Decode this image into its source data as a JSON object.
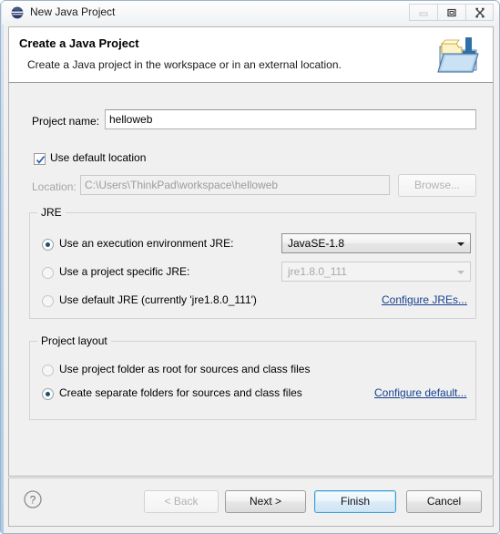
{
  "window": {
    "title": "New Java Project",
    "icon": "eclipse-globe-icon",
    "controls": {
      "minimize": "minimize-icon",
      "maximize": "maximize-icon",
      "close": "close-icon"
    }
  },
  "header": {
    "title": "Create a Java Project",
    "subtitle": "Create a Java project in the workspace or in an external location.",
    "icon": "new-java-project-banner-icon"
  },
  "form": {
    "project_name_label": "Project name:",
    "project_name_value": "helloweb",
    "project_name_placeholder": "",
    "use_default_location_label": "Use default location",
    "use_default_location_checked": true,
    "location_label": "Location:",
    "location_value": "C:\\Users\\ThinkPad\\workspace\\helloweb",
    "browse_label": "Browse..."
  },
  "jre": {
    "group_title": "JRE",
    "options": [
      {
        "label": "Use an execution environment JRE:",
        "selected": true
      },
      {
        "label": "Use a project specific JRE:",
        "selected": false
      },
      {
        "label": "Use default JRE (currently 'jre1.8.0_111')",
        "selected": false
      }
    ],
    "execution_env_value": "JavaSE-1.8",
    "project_jre_value": "jre1.8.0_111",
    "configure_link": "Configure JREs..."
  },
  "project_layout": {
    "group_title": "Project layout",
    "options": [
      {
        "label": "Use project folder as root for sources and class files",
        "selected": false
      },
      {
        "label": "Create separate folders for sources and class files",
        "selected": true
      }
    ],
    "configure_link": "Configure default..."
  },
  "footer": {
    "help_icon": "help-icon",
    "back_label": "< Back",
    "next_label": "Next >",
    "finish_label": "Finish",
    "cancel_label": "Cancel"
  },
  "colors": {
    "link": "#17418f",
    "default_button_border": "#3c9fd4",
    "radio_dot": "#16536e",
    "window_bg": "#f0f0f0"
  }
}
